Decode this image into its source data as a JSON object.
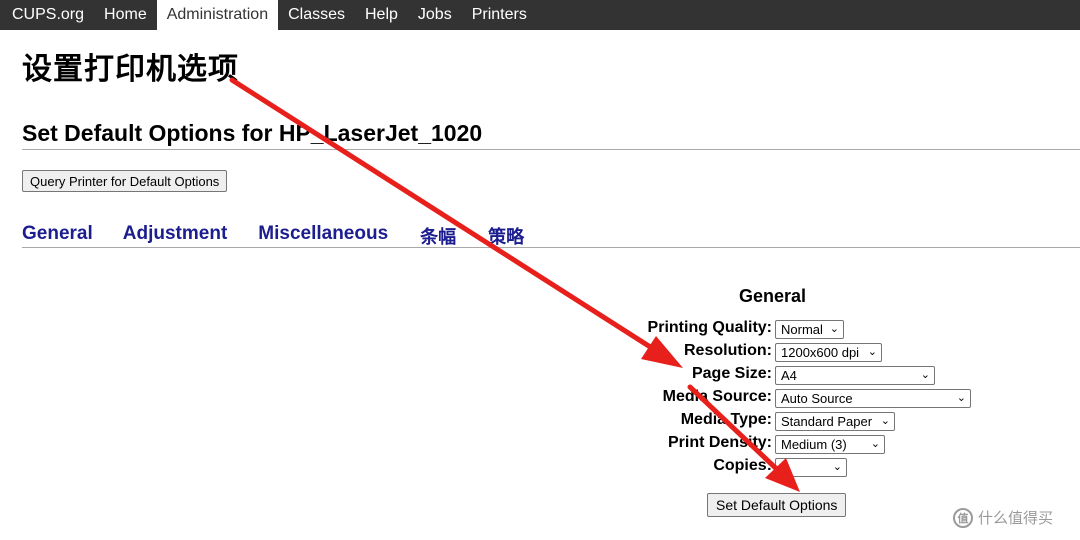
{
  "nav": {
    "items": [
      {
        "label": "CUPS.org"
      },
      {
        "label": "Home"
      },
      {
        "label": "Administration"
      },
      {
        "label": "Classes"
      },
      {
        "label": "Help"
      },
      {
        "label": "Jobs"
      },
      {
        "label": "Printers"
      }
    ],
    "active": "Administration"
  },
  "page": {
    "heading": "设置打印机选项",
    "printer_heading": "Set Default Options for HP_LaserJet_1020",
    "query_button": "Query Printer for Default Options"
  },
  "tabs": [
    {
      "label": "General"
    },
    {
      "label": "Adjustment"
    },
    {
      "label": "Miscellaneous"
    },
    {
      "label": "条幅"
    },
    {
      "label": "策略"
    }
  ],
  "section": {
    "title": "General",
    "options": [
      {
        "label": "Printing Quality:",
        "value": "Normal"
      },
      {
        "label": "Resolution:",
        "value": "1200x600 dpi"
      },
      {
        "label": "Page Size:",
        "value": "A4"
      },
      {
        "label": "Media Source:",
        "value": "Auto Source"
      },
      {
        "label": "Media Type:",
        "value": "Standard Paper"
      },
      {
        "label": "Print Density:",
        "value": "Medium (3)"
      },
      {
        "label": "Copies:",
        "value": "1"
      }
    ],
    "submit_button": "Set Default Options"
  },
  "annotation": {
    "arrow_color": "#e8201c"
  },
  "watermark": {
    "logo_text": "值",
    "text": "什么值得买"
  }
}
